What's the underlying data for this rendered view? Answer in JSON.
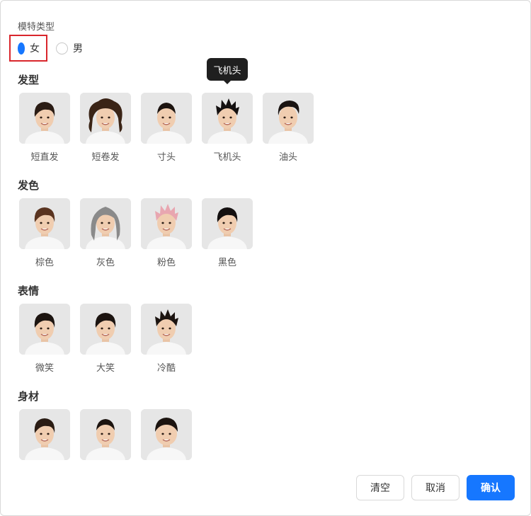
{
  "model_type": {
    "label": "模特类型",
    "options": [
      {
        "label": "女",
        "selected": true
      },
      {
        "label": "男",
        "selected": false
      }
    ]
  },
  "sections": [
    {
      "title": "发型",
      "items": [
        {
          "label": "短直发",
          "hair": "#2a1c14",
          "style": "short"
        },
        {
          "label": "短卷发",
          "hair": "#3a2416",
          "style": "curly"
        },
        {
          "label": "寸头",
          "hair": "#1c1410",
          "style": "buzz"
        },
        {
          "label": "飞机头",
          "hair": "#141010",
          "style": "spiky"
        },
        {
          "label": "油头",
          "hair": "#1a1412",
          "style": "slick"
        }
      ]
    },
    {
      "title": "发色",
      "items": [
        {
          "label": "棕色",
          "hair": "#5a3420",
          "style": "short"
        },
        {
          "label": "灰色",
          "hair": "#8a8a8a",
          "style": "long"
        },
        {
          "label": "粉色",
          "hair": "#e8a6b0",
          "style": "spiky"
        },
        {
          "label": "黑色",
          "hair": "#141010",
          "style": "short"
        }
      ]
    },
    {
      "title": "表情",
      "items": [
        {
          "label": "微笑",
          "hair": "#1c1410",
          "style": "short"
        },
        {
          "label": "大笑",
          "hair": "#1c1410",
          "style": "short"
        },
        {
          "label": "冷酷",
          "hair": "#1c1410",
          "style": "spiky"
        }
      ]
    },
    {
      "title": "身材",
      "items": [
        {
          "label": "",
          "hair": "#2a1c14",
          "style": "short"
        },
        {
          "label": "",
          "hair": "#1c1410",
          "style": "buzz"
        },
        {
          "label": "",
          "hair": "#1c1410",
          "style": "round"
        }
      ]
    }
  ],
  "tooltip": {
    "text": "飞机头"
  },
  "buttons": {
    "clear": "清空",
    "cancel": "取消",
    "confirm": "确认"
  },
  "colors": {
    "primary": "#1677ff",
    "highlight_border": "#d9262c",
    "tooltip_bg": "#1f1f1f"
  }
}
